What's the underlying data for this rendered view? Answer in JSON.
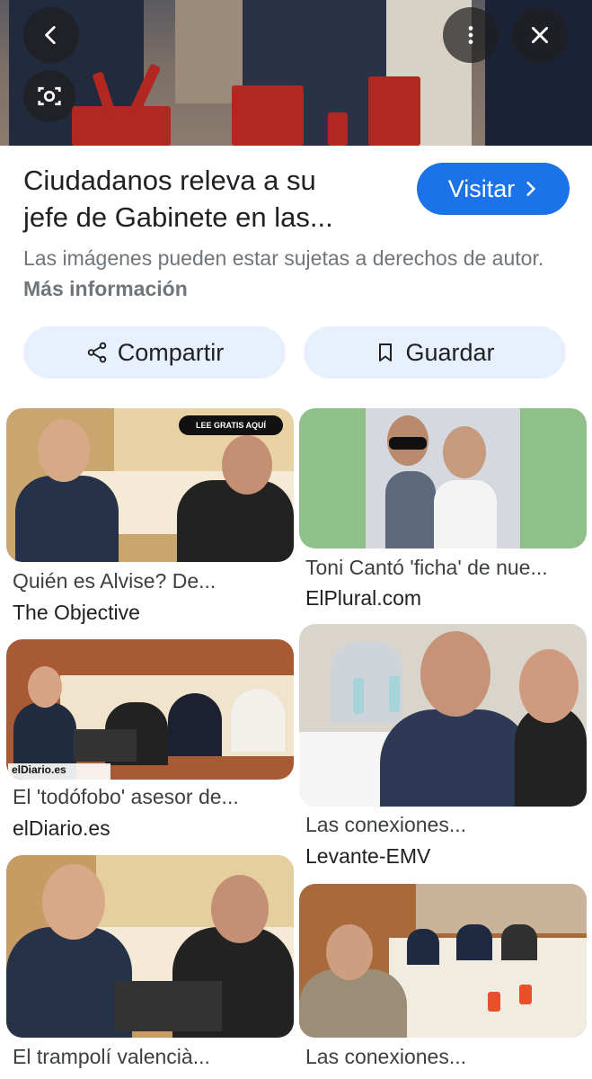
{
  "header": {
    "back_icon": "arrow-back-icon",
    "lens_icon": "camera-lens-icon",
    "more_icon": "more-vert-icon",
    "close_icon": "close-icon"
  },
  "result": {
    "title_line1": "Ciudadanos releva a su",
    "title_line2": "jefe de Gabinete en las...",
    "visit_label": "Visitar",
    "rights_text": "Las imágenes pueden estar sujetas a derechos de autor.",
    "more_info": "Más información",
    "share_label": "Compartir",
    "save_label": "Guardar"
  },
  "related": [
    {
      "title": "Quién es Alvise? De...",
      "source": "The Objective",
      "badge": "LEE GRATIS AQUÍ"
    },
    {
      "title": "Toni Cantó 'ficha' de nue...",
      "source": "ElPlural.com"
    },
    {
      "title": "El 'todófobo' asesor de...",
      "source": "elDiario.es",
      "watermark": "elDiario.es"
    },
    {
      "title": "Las conexiones...",
      "source": "Levante-EMV"
    },
    {
      "title": "El trampolí valencià...",
      "source": ""
    },
    {
      "title": "Las conexiones...",
      "source": ""
    }
  ],
  "colors": {
    "accent": "#1a73e8",
    "button_bg": "#e8f0fe",
    "muted_text": "#70757a"
  }
}
